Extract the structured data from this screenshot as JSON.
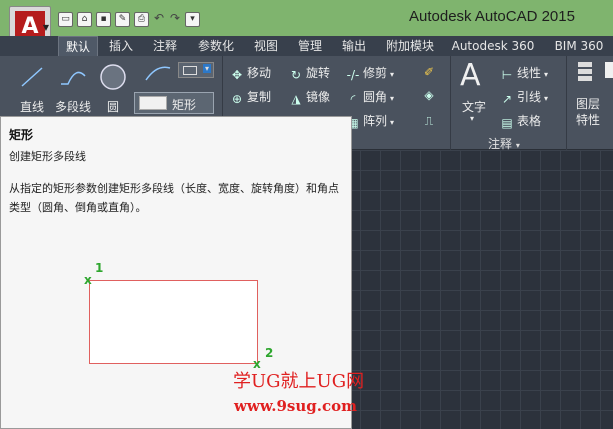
{
  "app": {
    "title": "Autodesk AutoCAD 2015",
    "logo_letter": "A"
  },
  "tabs": [
    "默认",
    "插入",
    "注释",
    "参数化",
    "视图",
    "管理",
    "输出",
    "附加模块",
    "Autodesk 360",
    "BIM 360"
  ],
  "draw_panel": {
    "line": "直线",
    "polyline": "多段线",
    "circle": "圆",
    "rectangle": "矩形"
  },
  "modify_panel": {
    "move": "移动",
    "rotate": "旋转",
    "trim": "修剪",
    "copy": "复制",
    "mirror": "镜像",
    "fillet": "圆角",
    "array": "阵列"
  },
  "annotation_panel": {
    "text": "文字",
    "linear": "线性",
    "leader": "引线",
    "table": "表格",
    "label": "注释"
  },
  "layers_panel": {
    "layer_props": "图层\n特性"
  },
  "tooltip": {
    "title": "矩形",
    "subtitle": "创建矩形多段线",
    "description": "从指定的矩形参数创建矩形多段线（长度、宽度、旋转角度）和角点类型（圆角、倒角或直角）。",
    "point1": "1",
    "point2": "2",
    "mark": "x"
  },
  "watermark": {
    "line1": "学UG就上UG网",
    "line2": "www.9sug.com"
  }
}
